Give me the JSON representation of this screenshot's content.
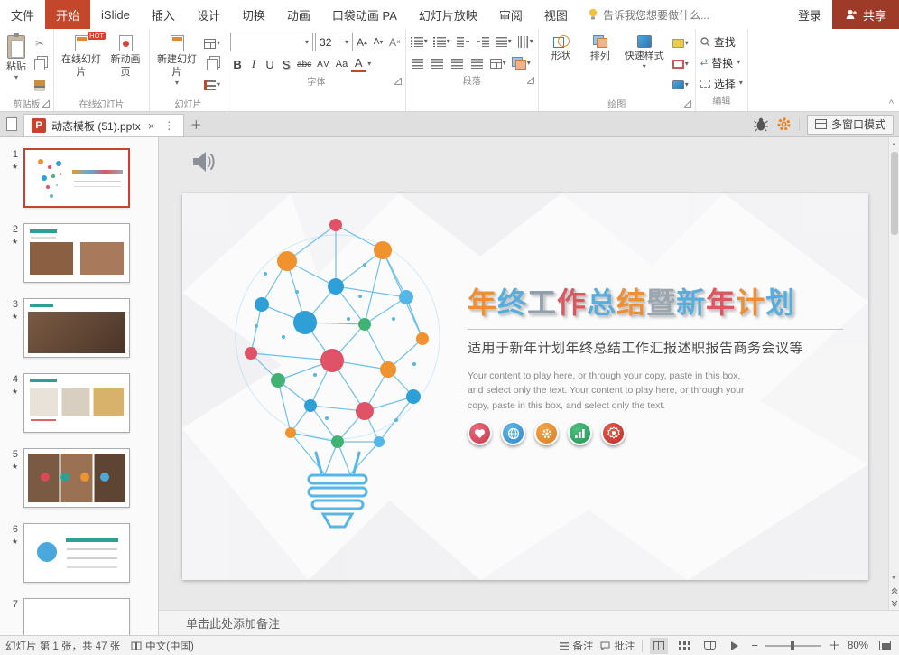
{
  "icons": {
    "dropdown": "▾",
    "scissors": "✂",
    "close": "×",
    "menu": "⋮",
    "add": "＋",
    "star": "★",
    "collapse": "^",
    "ppt_letter": "P"
  },
  "tabs": {
    "items": [
      {
        "label": "文件"
      },
      {
        "label": "开始",
        "active": true
      },
      {
        "label": "iSlide"
      },
      {
        "label": "插入"
      },
      {
        "label": "设计"
      },
      {
        "label": "切换"
      },
      {
        "label": "动画"
      },
      {
        "label": "口袋动画 PA"
      },
      {
        "label": "幻灯片放映"
      },
      {
        "label": "审阅"
      },
      {
        "label": "视图"
      }
    ],
    "tell_me": "告诉我您想要做什么...",
    "sign_in": "登录",
    "share": "共享"
  },
  "ribbon": {
    "clipboard": {
      "paste": "粘贴",
      "label": "剪贴板"
    },
    "online": {
      "online_slides": "在线幻灯片",
      "new_anim": "新动画页",
      "hot_badge": "HOT",
      "label": "在线幻灯片"
    },
    "slides": {
      "new_slide": "新建幻灯片",
      "label": "幻灯片"
    },
    "font": {
      "name": "",
      "size": "32",
      "bold": "B",
      "italic": "I",
      "underline": "U",
      "shadow": "S",
      "strike": "abc",
      "spacing": "AV",
      "case": "Aa",
      "color": "A",
      "label": "字体"
    },
    "paragraph": {
      "label": "段落"
    },
    "drawing": {
      "shapes": "形状",
      "arrange": "排列",
      "quick_styles": "快速样式",
      "label": "绘图"
    },
    "editing": {
      "find": "查找",
      "replace": "替换",
      "select": "选择",
      "label": "编辑"
    }
  },
  "doc_bar": {
    "file_name": "动态模板 (51).pptx",
    "multi_window": "多窗口模式"
  },
  "panel": {
    "slides": [
      {
        "n": "1",
        "starred": true,
        "selected": true
      },
      {
        "n": "2",
        "starred": true
      },
      {
        "n": "3",
        "starred": true
      },
      {
        "n": "4",
        "starred": true
      },
      {
        "n": "5",
        "starred": true
      },
      {
        "n": "6",
        "starred": true
      },
      {
        "n": "7",
        "starred": false
      }
    ]
  },
  "slide": {
    "title": "年终工作总结暨新年计划",
    "title_colors": [
      "#EE8F35",
      "#55AEDD",
      "#8FA0AC",
      "#DB5860",
      "#55AEDD",
      "#EE8F35",
      "#9AA7B0",
      "#55AEDD",
      "#DB5860",
      "#EE8F35",
      "#55AEDD"
    ],
    "subtitle": "适用于新年计划年终总结工作汇报述职报告商务会议等",
    "body": "Your content to play here, or through your copy, paste in this box, and select only the text. Your content to play here, or through your copy, paste in this box, and select only the text.",
    "accent_colors": {
      "orange": "#F0932F",
      "red": "#E05266",
      "blue": "#2F9FD8",
      "light_blue": "#55B6E8",
      "green": "#41B273"
    }
  },
  "notes": {
    "placeholder": "单击此处添加备注"
  },
  "status": {
    "slide_info": "幻灯片 第 1 张，共 47 张",
    "language": "中文(中国)",
    "notes": "备注",
    "comments": "批注",
    "zoom": "80%"
  }
}
